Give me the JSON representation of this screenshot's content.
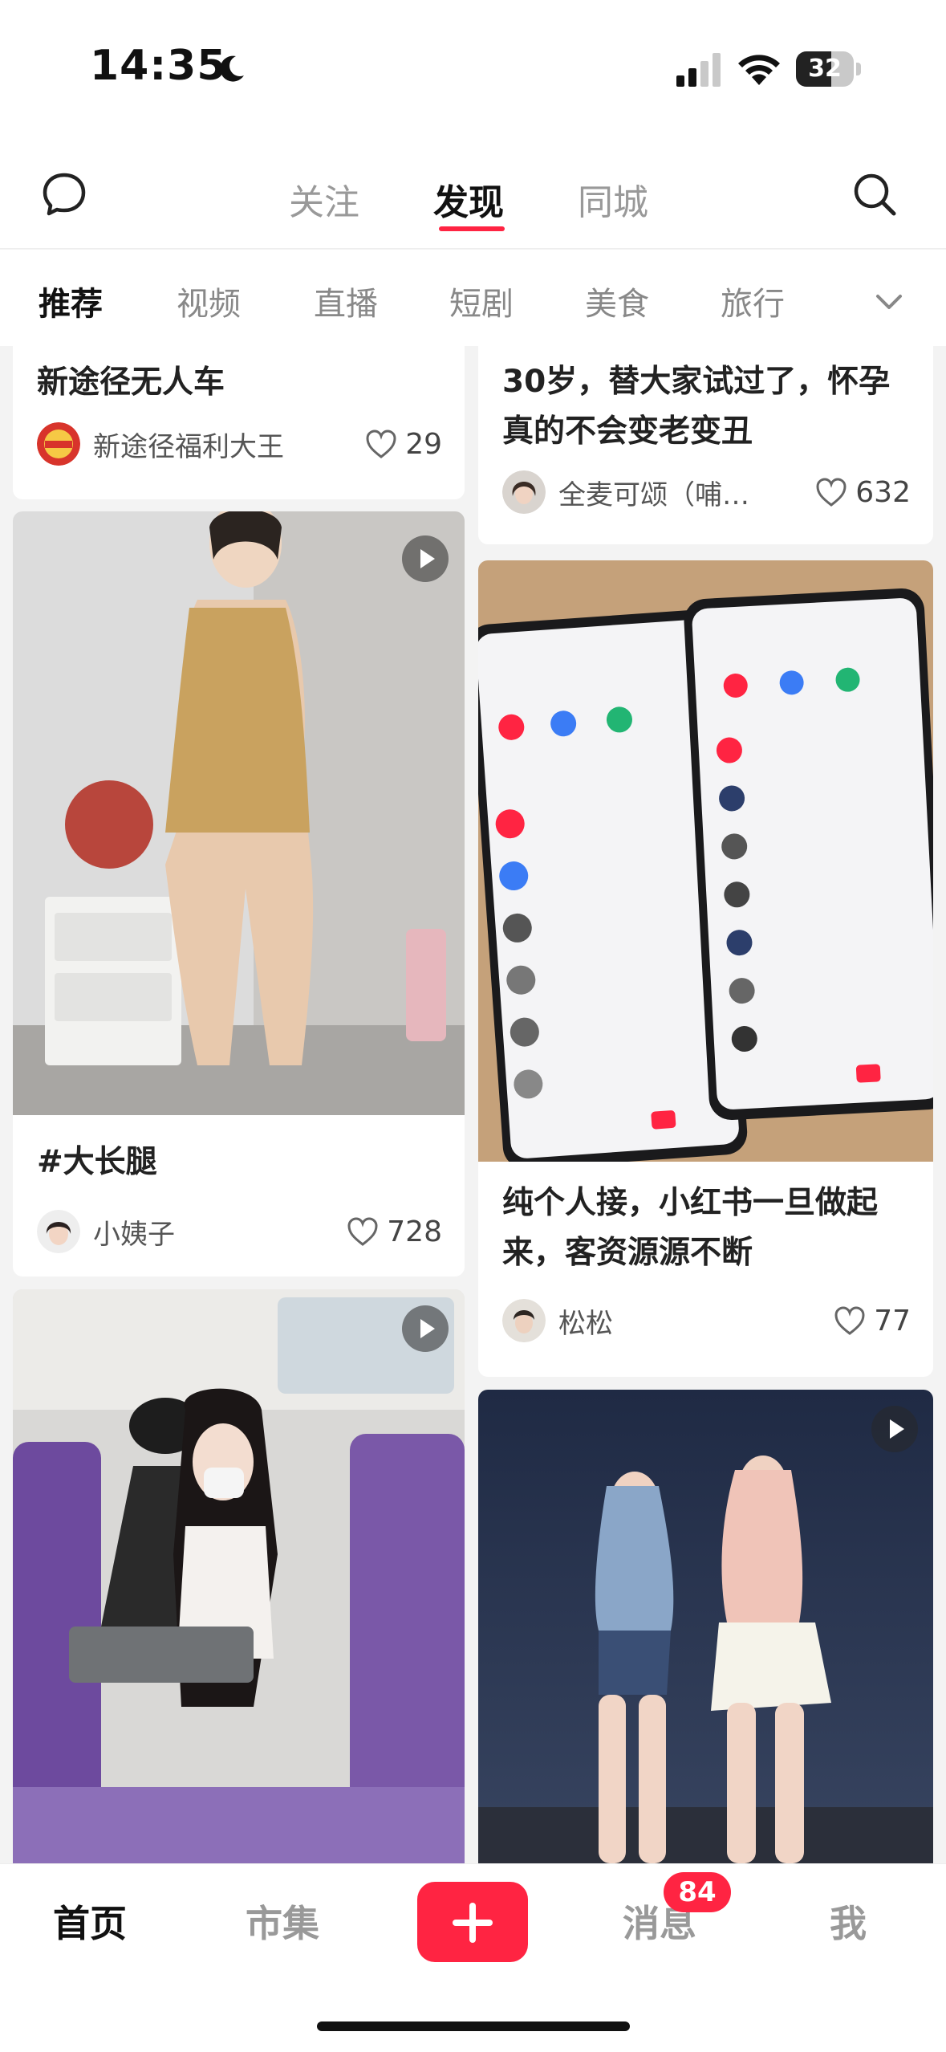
{
  "status": {
    "time": "14:35",
    "battery": "32"
  },
  "nav": {
    "tabs": [
      "关注",
      "发现",
      "同城"
    ],
    "active": "发现"
  },
  "categories": [
    "推荐",
    "视频",
    "直播",
    "短剧",
    "美食",
    "旅行"
  ],
  "feed": {
    "left": [
      {
        "title": "新途径无人车",
        "author": "新途径福利大王",
        "likes": "29"
      },
      {
        "title": "#大长腿",
        "author": "小姨子",
        "likes": "728",
        "video": true
      },
      {
        "video": true
      }
    ],
    "right": [
      {
        "title": "30岁，替大家试过了，怀孕真的不会变老变丑",
        "author": "全麦可颂（哺…",
        "likes": "632"
      },
      {
        "title": "纯个人接，小红书一旦做起来，客资源源不断",
        "author": "松松",
        "likes": "77"
      },
      {
        "video": true
      }
    ]
  },
  "bottom_tabs": {
    "home": "首页",
    "market": "市集",
    "messages": "消息",
    "me": "我",
    "messages_badge": "84"
  },
  "colors": {
    "accent": "#ff2442",
    "background": "#f3f3f3"
  }
}
